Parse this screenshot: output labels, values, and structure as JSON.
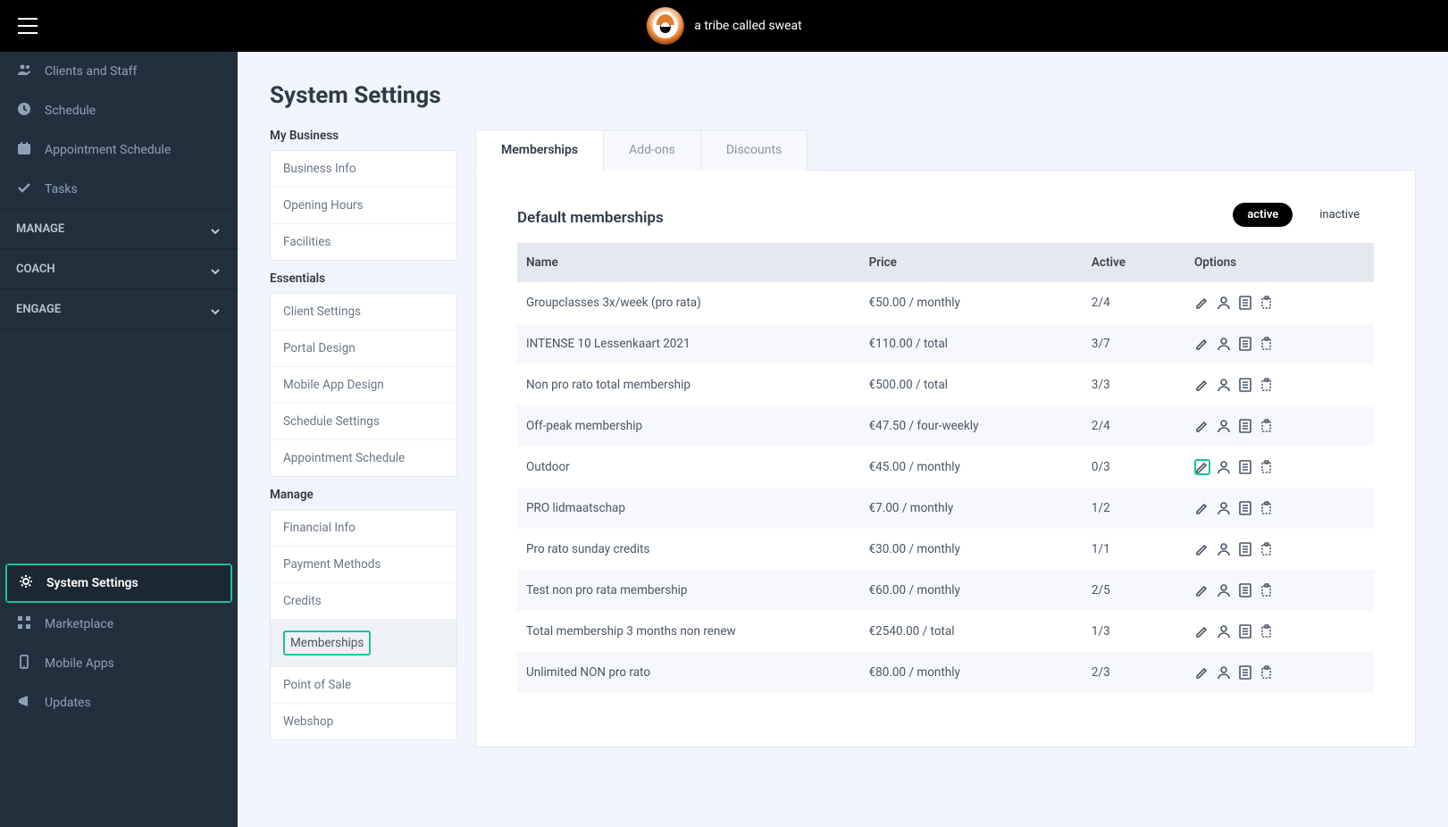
{
  "brand": {
    "name": "a tribe called sweat"
  },
  "sidebar": {
    "items": [
      {
        "icon": "people",
        "label": "Clients and Staff"
      },
      {
        "icon": "clock",
        "label": "Schedule"
      },
      {
        "icon": "calendar",
        "label": "Appointment Schedule"
      },
      {
        "icon": "check",
        "label": "Tasks"
      }
    ],
    "sections": [
      {
        "label": "MANAGE"
      },
      {
        "label": "COACH"
      },
      {
        "label": "ENGAGE"
      }
    ],
    "bottom": [
      {
        "icon": "gear",
        "label": "System Settings",
        "active": true,
        "highlight": true
      },
      {
        "icon": "grid",
        "label": "Marketplace"
      },
      {
        "icon": "phone",
        "label": "Mobile Apps"
      },
      {
        "icon": "megaphone",
        "label": "Updates"
      }
    ]
  },
  "page": {
    "title": "System Settings"
  },
  "settings_nav": {
    "groups": [
      {
        "title": "My Business",
        "items": [
          "Business Info",
          "Opening Hours",
          "Facilities"
        ]
      },
      {
        "title": "Essentials",
        "items": [
          "Client Settings",
          "Portal Design",
          "Mobile App Design",
          "Schedule Settings",
          "Appointment Schedule"
        ]
      },
      {
        "title": "Manage",
        "items": [
          "Financial Info",
          "Payment Methods",
          "Credits",
          "Memberships",
          "Point of Sale",
          "Webshop"
        ],
        "selected": "Memberships"
      }
    ]
  },
  "tabs": {
    "items": [
      "Memberships",
      "Add-ons",
      "Discounts"
    ],
    "active": "Memberships"
  },
  "membership_panel": {
    "heading": "Default memberships",
    "filter_active": "active",
    "filter_inactive": "inactive",
    "columns": {
      "name": "Name",
      "price": "Price",
      "active": "Active",
      "options": "Options"
    },
    "rows": [
      {
        "name": "Groupclasses 3x/week (pro rata)",
        "price": "€50.00 / monthly",
        "active": "2/4",
        "highlight_edit": false
      },
      {
        "name": "INTENSE 10 Lessenkaart 2021",
        "price": "€110.00 / total",
        "active": "3/7",
        "highlight_edit": false
      },
      {
        "name": "Non pro rato total membership",
        "price": "€500.00 / total",
        "active": "3/3",
        "highlight_edit": false
      },
      {
        "name": "Off-peak membership",
        "price": "€47.50 / four-weekly",
        "active": "2/4",
        "highlight_edit": false
      },
      {
        "name": "Outdoor",
        "price": "€45.00 / monthly",
        "active": "0/3",
        "highlight_edit": true
      },
      {
        "name": "PRO lidmaatschap",
        "price": "€7.00 / monthly",
        "active": "1/2",
        "highlight_edit": false
      },
      {
        "name": "Pro rato sunday credits",
        "price": "€30.00 / monthly",
        "active": "1/1",
        "highlight_edit": false
      },
      {
        "name": "Test non pro rata membership",
        "price": "€60.00 / monthly",
        "active": "2/5",
        "highlight_edit": false
      },
      {
        "name": "Total membership 3 months non renew",
        "price": "€2540.00 / total",
        "active": "1/3",
        "highlight_edit": false
      },
      {
        "name": "Unlimited NON pro rato",
        "price": "€80.00 / monthly",
        "active": "2/3",
        "highlight_edit": false
      }
    ]
  }
}
